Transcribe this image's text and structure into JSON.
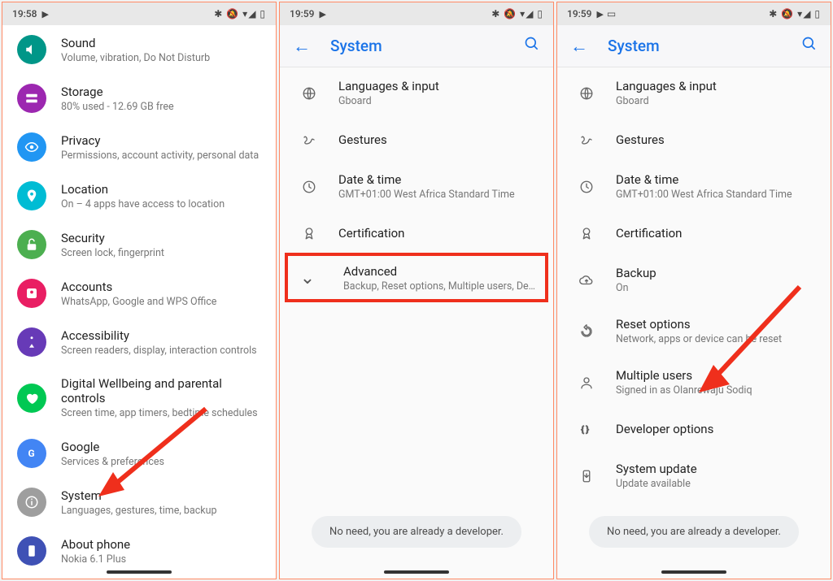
{
  "status": {
    "time1": "19:58",
    "time2": "19:59",
    "time3": "19:59"
  },
  "appbar": {
    "title": "System"
  },
  "phone1": {
    "rows": [
      {
        "title": "Sound",
        "sub": "Volume, vibration, Do Not Disturb",
        "name": "sound",
        "color": "bg-teal",
        "icon": "volume"
      },
      {
        "title": "Storage",
        "sub": "80% used - 12.69 GB free",
        "name": "storage",
        "color": "bg-purple",
        "icon": "storage"
      },
      {
        "title": "Privacy",
        "sub": "Permissions, account activity, personal data",
        "name": "privacy",
        "color": "bg-blue",
        "icon": "eye"
      },
      {
        "title": "Location",
        "sub": "On – 4 apps have access to location",
        "name": "location",
        "color": "bg-amber",
        "icon": "pin"
      },
      {
        "title": "Security",
        "sub": "Screen lock, fingerprint",
        "name": "security",
        "color": "bg-green",
        "icon": "lock"
      },
      {
        "title": "Accounts",
        "sub": "WhatsApp, Google and WPS Office",
        "name": "accounts",
        "color": "bg-pink",
        "icon": "person"
      },
      {
        "title": "Accessibility",
        "sub": "Screen readers, display, interaction controls",
        "name": "accessibility",
        "color": "bg-deep",
        "icon": "a11y"
      },
      {
        "title": "Digital Wellbeing and parental controls",
        "sub": "Screen time, app timers, bedtime schedules",
        "name": "digital-wellbeing",
        "color": "bg-lime",
        "icon": "heart"
      },
      {
        "title": "Google",
        "sub": "Services & preferences",
        "name": "google",
        "color": "bg-bluebtn",
        "icon": "g"
      },
      {
        "title": "System",
        "sub": "Languages, gestures, time, backup",
        "name": "system",
        "color": "bg-grey",
        "icon": "info"
      },
      {
        "title": "About phone",
        "sub": "Nokia 6.1 Plus",
        "name": "about-phone",
        "color": "bg-ind",
        "icon": "phone"
      }
    ]
  },
  "phone2": {
    "rows": [
      {
        "title": "Languages & input",
        "sub": "Gboard",
        "name": "languages-input",
        "icon": "globe"
      },
      {
        "title": "Gestures",
        "sub": "",
        "name": "gestures",
        "icon": "gesture"
      },
      {
        "title": "Date & time",
        "sub": "GMT+01:00 West Africa Standard Time",
        "name": "date-time",
        "icon": "clock"
      },
      {
        "title": "Certification",
        "sub": "",
        "name": "certification",
        "icon": "badge"
      }
    ],
    "advanced": {
      "title": "Advanced",
      "sub": "Backup, Reset options, Multiple users, Developer o.."
    },
    "toast": "No need, you are already a developer."
  },
  "phone3": {
    "rows": [
      {
        "title": "Languages & input",
        "sub": "Gboard",
        "name": "languages-input",
        "icon": "globe"
      },
      {
        "title": "Gestures",
        "sub": "",
        "name": "gestures",
        "icon": "gesture"
      },
      {
        "title": "Date & time",
        "sub": "GMT+01:00 West Africa Standard Time",
        "name": "date-time",
        "icon": "clock"
      },
      {
        "title": "Certification",
        "sub": "",
        "name": "certification",
        "icon": "badge"
      },
      {
        "title": "Backup",
        "sub": "On",
        "name": "backup",
        "icon": "cloud"
      },
      {
        "title": "Reset options",
        "sub": "Network, apps or device can be reset",
        "name": "reset-options",
        "icon": "reset"
      },
      {
        "title": "Multiple users",
        "sub": "Signed in as Olanrewaju Sodiq",
        "name": "multiple-users",
        "icon": "user"
      },
      {
        "title": "Developer options",
        "sub": "",
        "name": "developer-options",
        "icon": "braces"
      },
      {
        "title": "System update",
        "sub": "Update available",
        "name": "system-update",
        "icon": "update"
      }
    ],
    "toast": "No need, you are already a developer."
  }
}
